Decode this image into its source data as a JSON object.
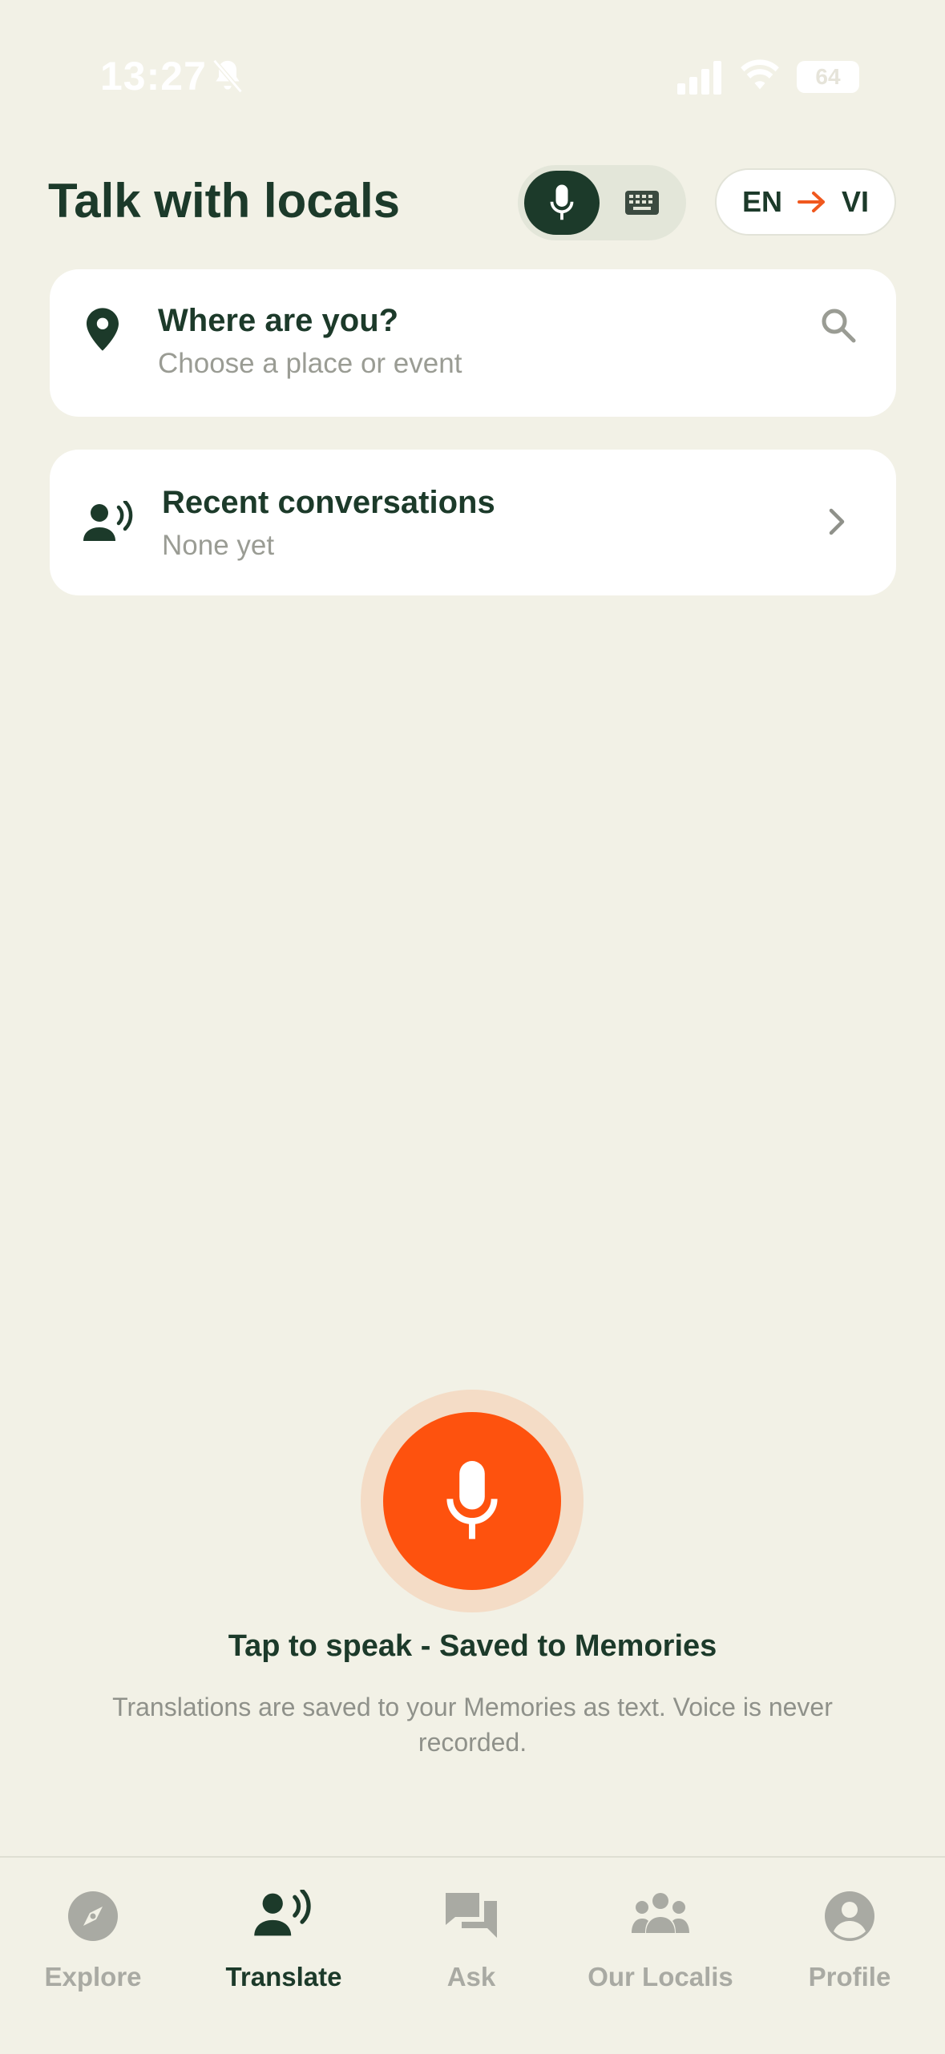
{
  "status_bar": {
    "time": "13:27",
    "battery": "64",
    "icons": [
      "bell-off-icon",
      "signal-icon",
      "wifi-icon",
      "battery-icon"
    ]
  },
  "header": {
    "title": "Talk with locals",
    "mode_toggle": {
      "selected": "voice",
      "options": [
        "mic-icon",
        "keyboard-icon"
      ]
    },
    "language": {
      "from": "EN",
      "to": "VI",
      "arrow_icon": "arrow-right-icon"
    }
  },
  "location_card": {
    "title": "Where are you?",
    "subtitle": "Choose a place or event",
    "icon": "location-pin-icon",
    "action_icon": "search-icon"
  },
  "recent_card": {
    "title": "Recent conversations",
    "subtitle": "None yet",
    "icon": "person-speaking-icon",
    "action_icon": "chevron-right-icon"
  },
  "speak": {
    "button_icon": "mic-icon",
    "title": "Tap to speak - Saved to Memories",
    "subtitle": "Translations are saved to your Memories as text. Voice is never recorded."
  },
  "nav": {
    "items": [
      {
        "label": "Explore",
        "icon": "compass-icon",
        "active": false
      },
      {
        "label": "Translate",
        "icon": "person-speaking-icon",
        "active": true
      },
      {
        "label": "Ask",
        "icon": "chat-bubbles-icon",
        "active": false
      },
      {
        "label": "Our Localis",
        "icon": "group-icon",
        "active": false
      },
      {
        "label": "Profile",
        "icon": "profile-icon",
        "active": false
      }
    ]
  },
  "colors": {
    "background": "#f2f1e6",
    "primary_dark": "#1c3a2a",
    "accent_orange": "#fe520e",
    "muted_text": "#9a9c94"
  }
}
